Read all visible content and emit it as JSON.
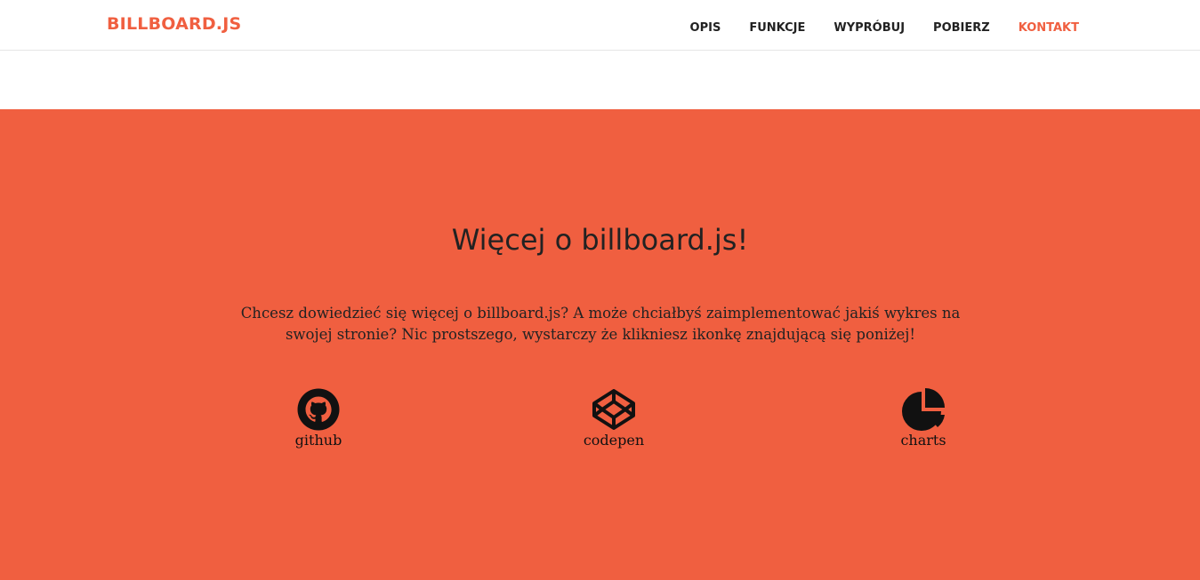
{
  "brand": "BILLBOARD.JS",
  "nav": {
    "items": [
      {
        "label": "OPIS"
      },
      {
        "label": "FUNKCJE"
      },
      {
        "label": "WYPRÓBUJ"
      },
      {
        "label": "POBIERZ"
      },
      {
        "label": "KONTAKT",
        "active": true
      }
    ]
  },
  "contact": {
    "heading": "Więcej o billboard.js!",
    "text": "Chcesz dowiedzieć się więcej o billboard.js? A może chciałbyś zaimplementować jakiś wykres na swojej stronie? Nic prostszego, wystarczy że klikniesz ikonkę znajdującą się poniżej!",
    "links": [
      {
        "label": "github",
        "icon": "github-icon"
      },
      {
        "label": "codepen",
        "icon": "codepen-icon"
      },
      {
        "label": "charts",
        "icon": "pie-chart-icon"
      }
    ]
  },
  "colors": {
    "accent": "#f05f40",
    "text": "#222222",
    "background": "#ffffff"
  }
}
